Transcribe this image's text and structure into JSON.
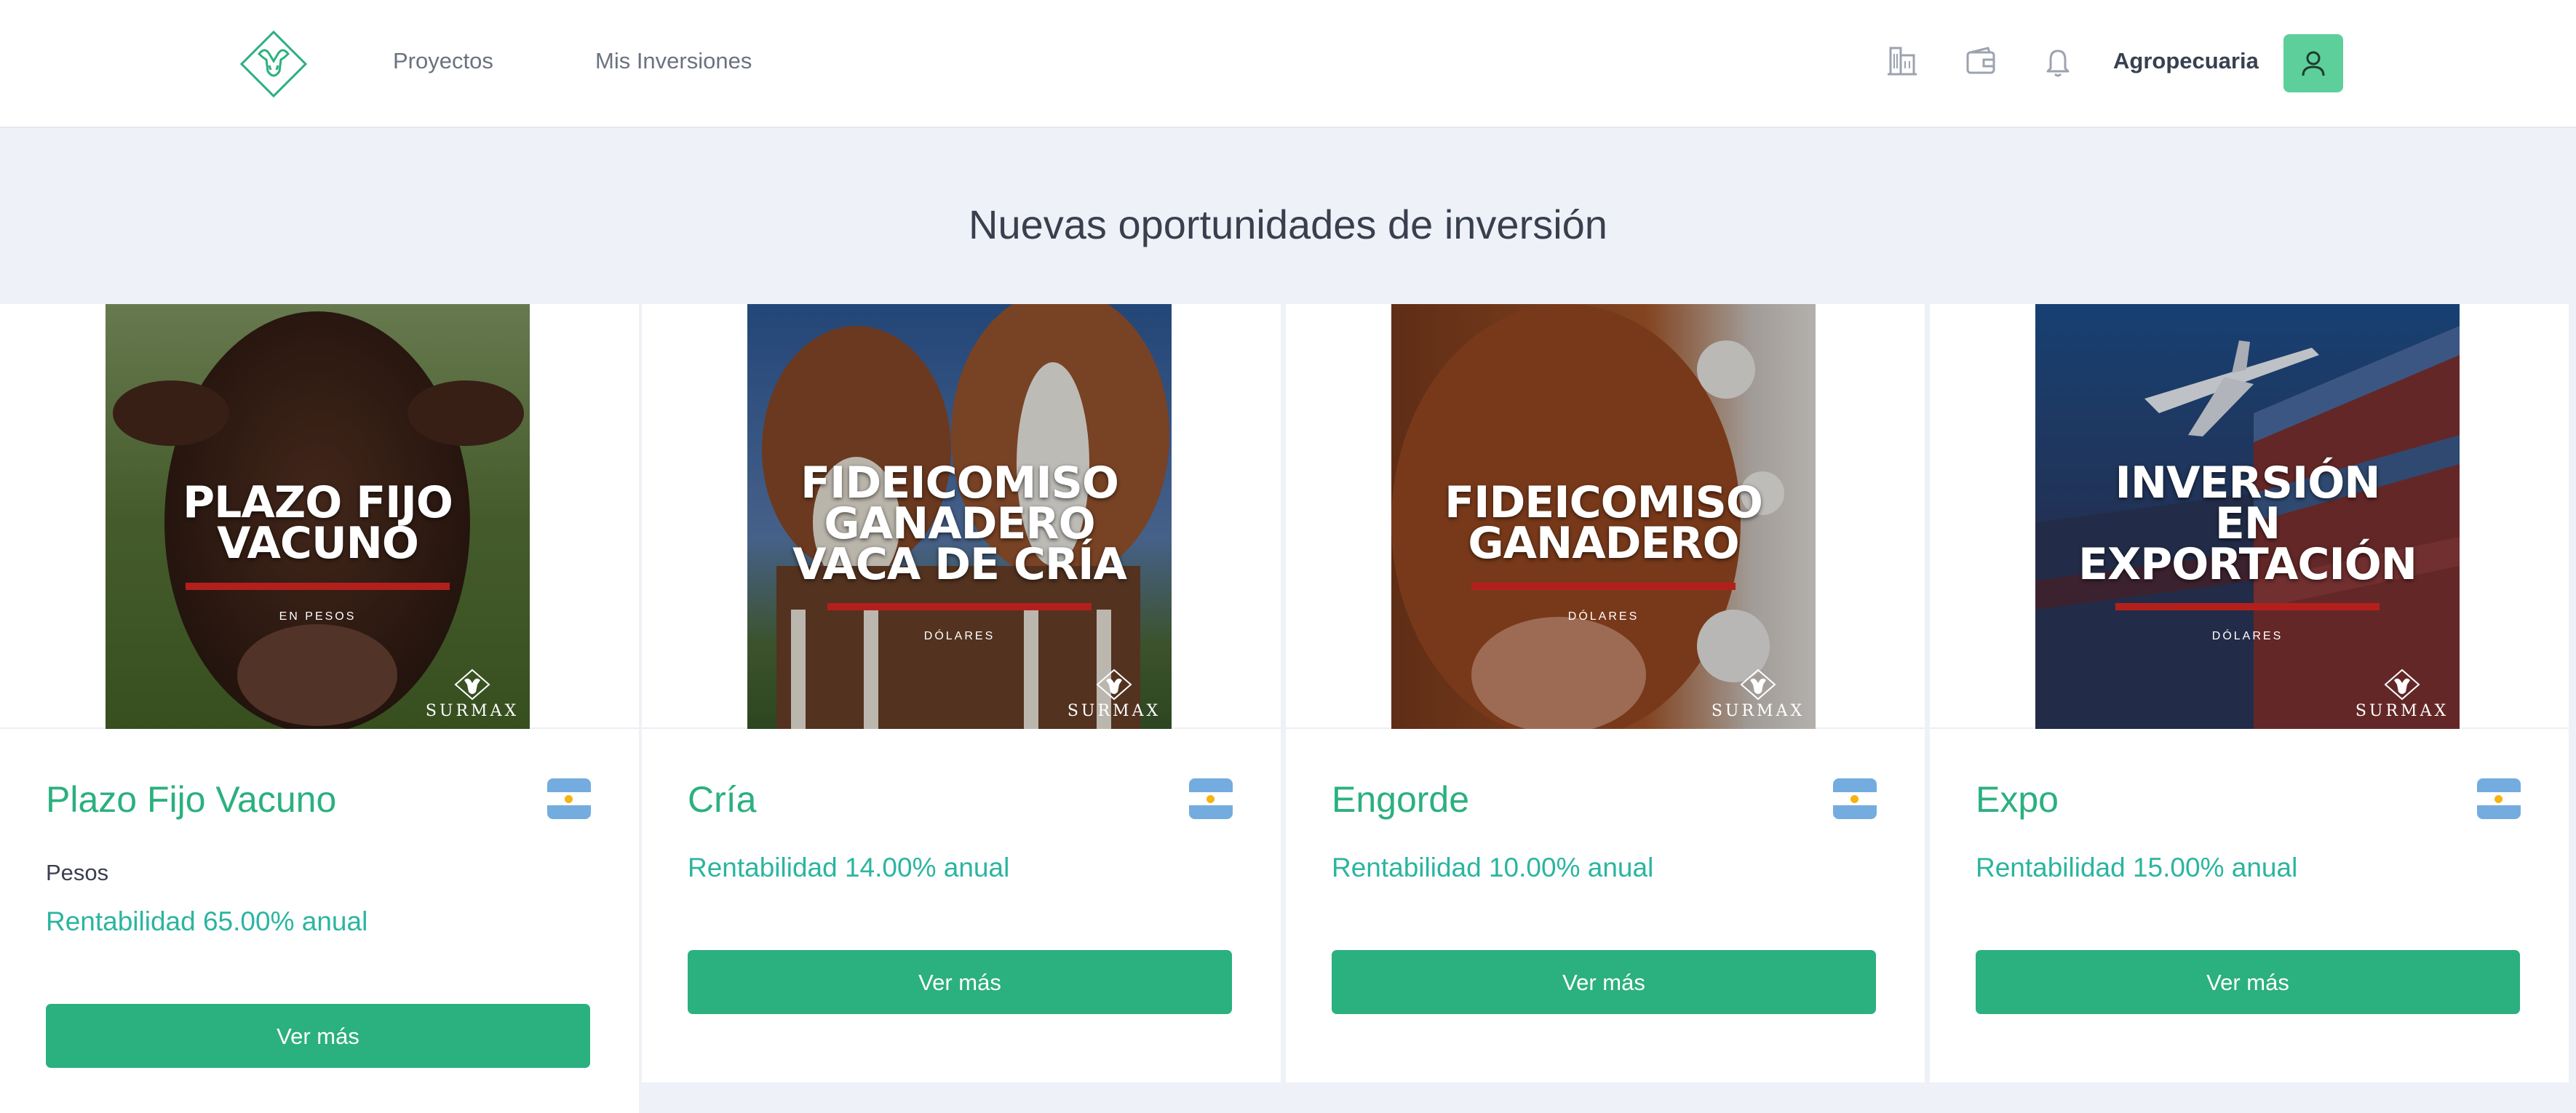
{
  "header": {
    "nav": {
      "projects": "Proyectos",
      "investments": "Mis Inversiones"
    },
    "username": "Agropecuaria",
    "icons": [
      "building-icon",
      "wallet-icon",
      "bell-icon",
      "user-icon"
    ],
    "colors": {
      "accent": "#2bb07f",
      "avatar_bg": "#5ccf9a"
    }
  },
  "main": {
    "title": "Nuevas oportunidades de inversión"
  },
  "cards": [
    {
      "name": "Plazo Fijo Vacuno",
      "currency": "Pesos",
      "rent": "Rentabilidad 65.00% anual",
      "button": "Ver más",
      "poster": {
        "title_l1": "PLAZO FIJO",
        "title_l2": "VACUNO",
        "subtitle": "EN PESOS",
        "brand": "SURMAX"
      }
    },
    {
      "name": "Cría",
      "rent": "Rentabilidad 14.00% anual",
      "button": "Ver más",
      "poster": {
        "title_l1": "FIDEICOMISO",
        "title_l2": "GANADERO",
        "title_l3": "VACA DE CRÍA",
        "subtitle": "DÓLARES",
        "brand": "SURMAX"
      }
    },
    {
      "name": "Engorde",
      "rent": "Rentabilidad 10.00% anual",
      "button": "Ver más",
      "poster": {
        "title_l1": "FIDEICOMISO",
        "title_l2": "GANADERO",
        "subtitle": "DÓLARES",
        "brand": "SURMAX"
      }
    },
    {
      "name": "Expo",
      "rent": "Rentabilidad 15.00% anual",
      "button": "Ver más",
      "poster": {
        "title_l1": "INVERSIÓN",
        "title_l2": "EN",
        "title_l3": "EXPORTACIÓN",
        "subtitle": "DÓLARES",
        "brand": "SURMAX"
      }
    }
  ]
}
